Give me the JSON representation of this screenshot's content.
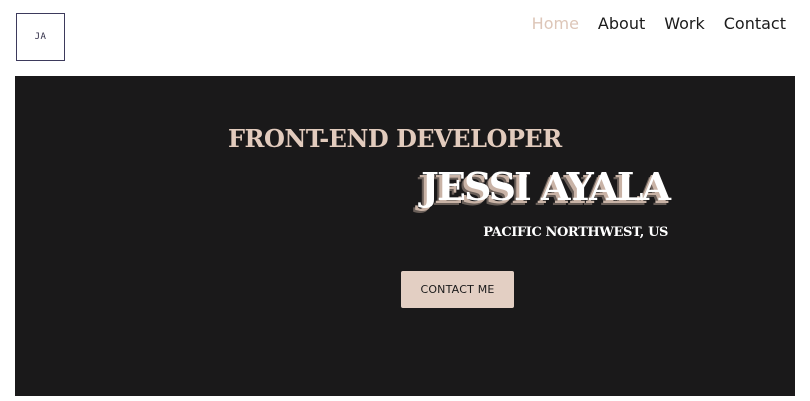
{
  "header": {
    "logo_text": "JA",
    "nav": [
      {
        "label": "Home",
        "active": true
      },
      {
        "label": "About",
        "active": false
      },
      {
        "label": "Work",
        "active": false
      },
      {
        "label": "Contact",
        "active": false
      }
    ]
  },
  "hero": {
    "subtitle": "FRONT-END DEVELOPER",
    "name": "JESSI AYALA",
    "location": "PACIFIC NORTHWEST, US",
    "cta_label": "CONTACT ME"
  },
  "colors": {
    "hero_background": "#1a191a",
    "accent": "#ddc6b8",
    "button_background": "#e3cfc3",
    "text_dark": "#1b1b1b"
  }
}
